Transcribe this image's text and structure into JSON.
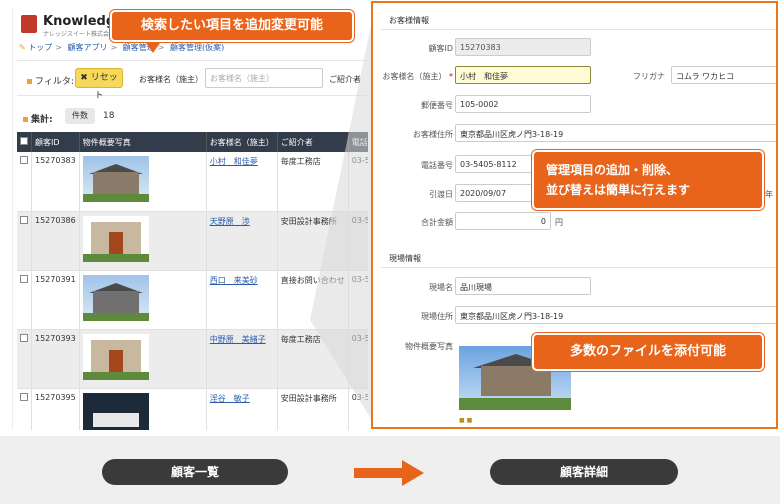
{
  "app": {
    "logo_text": "Knowledge",
    "logo_sub": "ナレッジスイート株式会社",
    "breadcrumb": [
      "トップ",
      "顧客アプリ",
      "顧客管理",
      "顧客管理(仮案)"
    ]
  },
  "filter": {
    "label": "フィルタ:",
    "reset_label": "リセット",
    "field_label": "お客様名（施主）",
    "field_placeholder": "お客様名（施主）",
    "field2_label": "ご紹介者"
  },
  "count": {
    "label": "集計:",
    "button": "件数",
    "value": "18"
  },
  "table": {
    "headers": [
      "顧客ID",
      "物件概要写真",
      "お客様名（施主）",
      "ご紹介者",
      "電話"
    ],
    "rows": [
      {
        "id": "15270383",
        "name": "小村　和佳夢",
        "introducer": "毎度工務店",
        "phone": "03-5"
      },
      {
        "id": "15270386",
        "name": "天野原　渉",
        "introducer": "安田設計事務所",
        "phone": "03-5"
      },
      {
        "id": "15270391",
        "name": "西口　来美砂",
        "introducer": "直接お問い合わせ",
        "phone": "03-5"
      },
      {
        "id": "15270393",
        "name": "中野原　美緒子",
        "introducer": "毎度工務店",
        "phone": "03-5"
      },
      {
        "id": "15270395",
        "name": "淫谷　敏子",
        "introducer": "安田設計事務所",
        "phone": "03-5"
      }
    ]
  },
  "detail": {
    "section1_title": "お客様情報",
    "customer_id_label": "顧客ID",
    "customer_id": "15270383",
    "name_label": "お客様名（施主）",
    "name_value": "小村　和佳夢",
    "furigana_label": "フリガナ",
    "furigana_value": "コムラ ワカヒコ",
    "postal_label": "郵便番号",
    "postal_value": "105-0002",
    "address_label": "お客様住所",
    "address_value": "東京都品川区虎ノ門3-18-19",
    "phone_label": "電話番号",
    "phone_value": "03-5405-8112",
    "handover_label": "引渡日",
    "handover_value": "2020/09/07",
    "handover_suffix": "年",
    "total_label": "合計金額",
    "total_value": "0",
    "total_unit": "円",
    "section2_title": "現場情報",
    "site_name_label": "現場名",
    "site_name_value": "品川現場",
    "site_address_label": "現場住所",
    "site_address_value": "東京都品川区虎ノ門3-18-19",
    "photo_label": "物件概要写真"
  },
  "callouts": {
    "top": "検索したい項目を追加変更可能",
    "mid_line1": "管理項目の追加・削除、",
    "mid_line2": "並び替えは簡単に行えます",
    "bottom": "多数のファイルを添付可能"
  },
  "footer": {
    "left_label": "顧客一覧",
    "right_label": "顧客詳細"
  },
  "colors": {
    "accent": "#e8641a",
    "table_header": "#333c4a",
    "pill": "#3a3a3a"
  }
}
